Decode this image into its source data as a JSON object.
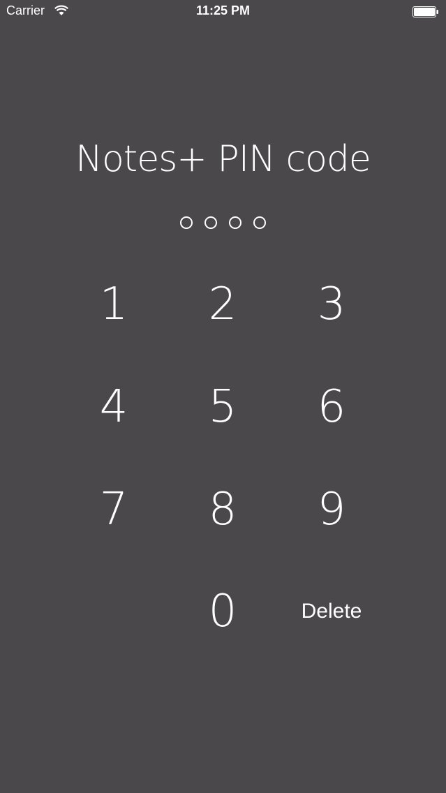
{
  "status_bar": {
    "carrier": "Carrier",
    "time": "11:25 PM",
    "wifi_icon": "wifi-icon",
    "battery_icon": "battery-icon"
  },
  "pin_screen": {
    "title": "Notes+ PIN code",
    "pin_length": 4,
    "digits_entered": 0
  },
  "keypad": {
    "keys": [
      "1",
      "2",
      "3",
      "4",
      "5",
      "6",
      "7",
      "8",
      "9",
      "0"
    ],
    "delete_label": "Delete"
  },
  "colors": {
    "background": "#4a484b",
    "foreground": "#ffffff"
  }
}
